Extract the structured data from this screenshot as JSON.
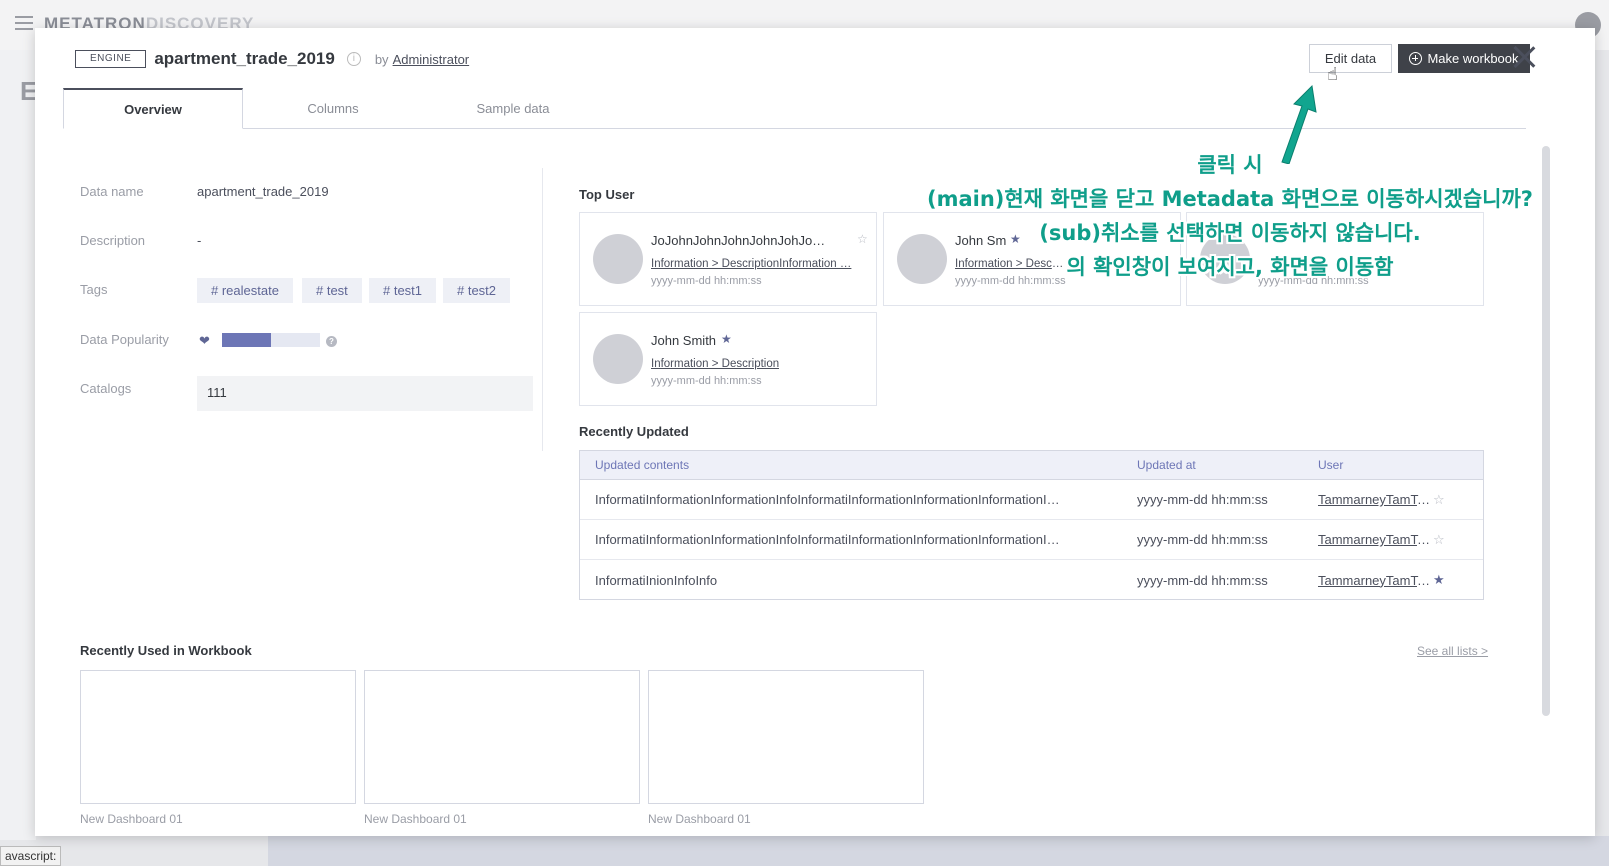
{
  "app": {
    "logo_strong": "METATRON",
    "logo_light": "DISCOVERY",
    "side_letter": "E",
    "status_url": "avascript:"
  },
  "header": {
    "engine_badge": "ENGINE",
    "title": "apartment_trade_2019",
    "info_icon": "i",
    "by_label": "by",
    "owner": "Administrator",
    "edit_button": "Edit data",
    "make_workbook_button": "Make workbook"
  },
  "tabs": [
    "Overview",
    "Columns",
    "Sample data"
  ],
  "overview": {
    "labels": {
      "data_name": "Data name",
      "description": "Description",
      "tags": "Tags",
      "popularity": "Data Popularity",
      "catalogs": "Catalogs"
    },
    "data_name": "apartment_trade_2019",
    "description": "-",
    "tags": [
      "# realestate",
      "# test",
      "# test1",
      "# test2"
    ],
    "popularity_level": 0.5,
    "popularity_icon": "heart-icon",
    "help_icon": "?",
    "catalog": "111"
  },
  "top_user": {
    "title": "Top User",
    "cards": [
      {
        "name": "JoJohnJohnJohnJohnJohJo…",
        "link": "Information > DescriptionInformation …",
        "date": "yyyy-mm-dd hh:mm:ss",
        "favorite": false
      },
      {
        "name": "John Sm",
        "link": "Information > Descri…",
        "date": "yyyy-mm-dd hh:mm:ss",
        "favorite": true
      },
      {
        "name": "",
        "link": "",
        "date": "yyyy-mm-dd hh:mm:ss",
        "favorite": false
      },
      {
        "name": "John Smith",
        "link": "Information > Description",
        "date": "yyyy-mm-dd hh:mm:ss",
        "favorite": true
      }
    ]
  },
  "recently_updated": {
    "title": "Recently Updated",
    "columns": [
      "Updated contents",
      "Updated at",
      "User"
    ],
    "rows": [
      {
        "content": "InformatiInformationInformationInfoInformatiInformationInformationInformationI…",
        "updated_at": "yyyy-mm-dd hh:mm:ss",
        "user": "TammarneyTamTa…",
        "favorite": false
      },
      {
        "content": "InformatiInformationInformationInfoInformatiInformationInformationInformationI…",
        "updated_at": "yyyy-mm-dd hh:mm:ss",
        "user": "TammarneyTamTa…",
        "favorite": false
      },
      {
        "content": "InformatiInionInfoInfo",
        "updated_at": "yyyy-mm-dd hh:mm:ss",
        "user": "TammarneyTamTa…",
        "favorite": true
      }
    ]
  },
  "workbooks": {
    "title": "Recently Used in Workbook",
    "see_all": "See all lists >",
    "items": [
      "New Dashboard 01",
      "New Dashboard 01",
      "New Dashboard 01"
    ]
  },
  "annotation": {
    "line1": "클릭 시",
    "line2": "(main)현재 화면을 닫고 Metadata 화면으로 이동하시겠습니까?",
    "line3": "(sub)취소를 선택하면 이동하지 않습니다.",
    "line4": "의 확인창이 보여지고, 화면을 이동함",
    "color": "#0f9e8a"
  },
  "colors": {
    "accent": "#6d76b6",
    "dark_button": "#3f4249",
    "tag_bg": "#eef0f6"
  }
}
